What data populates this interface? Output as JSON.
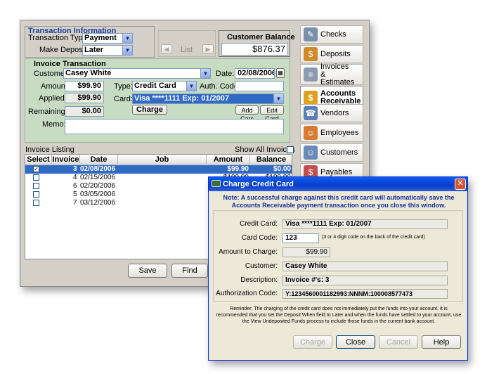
{
  "transaction_info": {
    "title": "Transaction Information",
    "type_label": "Transaction Type:",
    "type_value": "Payment",
    "deposit_label": "Make Deposit:",
    "deposit_value": "Later",
    "list_button": "List",
    "balance_label": "Customer Balance",
    "balance_value": "$876.37"
  },
  "invoice_transaction": {
    "title": "Invoice Transaction",
    "customer_label": "Customer:",
    "customer_value": "Casey White",
    "date_label": "Date:",
    "date_value": "02/08/2006",
    "amount_label": "Amount:",
    "amount_value": "$99.90",
    "type_label": "Type:",
    "type_value": "Credit Card",
    "auth_label": "Auth. Code:",
    "auth_value": "",
    "applied_label": "Applied:",
    "applied_value": "$99.90",
    "card_label": "Card:",
    "card_value": "Visa ****1111  Exp: 01/2007",
    "charge_button": "Charge",
    "add_card_button": "Add Carc",
    "edit_card_button": "Edit Card",
    "remaining_label": "Remaining:",
    "remaining_value": "$0.00",
    "memo_label": "Memo:",
    "memo_value": ""
  },
  "invoice_listing": {
    "title": "Invoice Listing",
    "show_all_label": "Show All Invoices",
    "columns": [
      "Select",
      "Invoice #",
      "Date",
      "Job",
      "Amount",
      "Balance"
    ],
    "rows": [
      {
        "checked": "✓",
        "invoice": "3",
        "date": "02/08/2006",
        "job": "",
        "amount": "$99.90",
        "balance": "$0.00",
        "selected": true
      },
      {
        "checked": "",
        "invoice": "4",
        "date": "02/15/2006",
        "job": "",
        "amount": "$199.90",
        "balance": "$199.90",
        "selected": false
      },
      {
        "checked": "",
        "invoice": "6",
        "date": "02/20/2006",
        "job": "",
        "amount": "",
        "balance": "",
        "selected": false
      },
      {
        "checked": "",
        "invoice": "5",
        "date": "03/05/2006",
        "job": "",
        "amount": "",
        "balance": "",
        "selected": false
      },
      {
        "checked": "",
        "invoice": "7",
        "date": "03/12/2006",
        "job": "",
        "amount": "",
        "balance": "",
        "selected": false
      }
    ]
  },
  "bottom_buttons": {
    "save": "Save",
    "find": "Find"
  },
  "sidebar": {
    "items": [
      {
        "label": "Checks",
        "icon": "checks-icon",
        "color": "#7a8fa8"
      },
      {
        "label": "Deposits",
        "icon": "deposits-icon",
        "color": "#d08a2a"
      },
      {
        "label": "Invoices & Estimates",
        "icon": "invoices-icon",
        "color": "#8c9bb0"
      },
      {
        "label": "Accounts Receivable",
        "icon": "accounts-receivable-icon",
        "color": "#e0a020"
      },
      {
        "label": "Vendors",
        "icon": "vendors-icon",
        "color": "#5a7fb8"
      },
      {
        "label": "Employees",
        "icon": "employees-icon",
        "color": "#d87a30"
      },
      {
        "label": "Customers",
        "icon": "customers-icon",
        "color": "#6a8ab8"
      },
      {
        "label": "Payables",
        "icon": "payables-icon",
        "color": "#c05050"
      }
    ]
  },
  "dialog": {
    "title": "Charge Credit Card",
    "note": "Note: A successful charge against this credit card will automatically save the Accounts Receivable payment transaction once you close this window.",
    "card_label": "Credit Card:",
    "card_value": "Visa ****1111  Exp: 01/2007",
    "code_label": "Card Code:",
    "code_value": "123",
    "code_hint": "(3 or 4 digit code on the back of the credit card)",
    "amount_label": "Amount to Charge:",
    "amount_value": "$99.90",
    "customer_label": "Customer:",
    "customer_value": "Casey White",
    "description_label": "Description:",
    "description_value": "Invoice #'s: 3",
    "auth_label": "Authorization Code:",
    "auth_value": "Y:1234560001182993:NNNM:100008577473",
    "reminder": "Reminder: The charging of the credit card does not immediately put the funds into your account. It is recommended that you set the Deposit When field to Later and when the funds have settled to your account, use the View Undeposited Funds process to include those funds in the current bank account.",
    "buttons": {
      "charge": "Charge",
      "close": "Close",
      "cancel": "Cancel",
      "help": "Help"
    }
  }
}
